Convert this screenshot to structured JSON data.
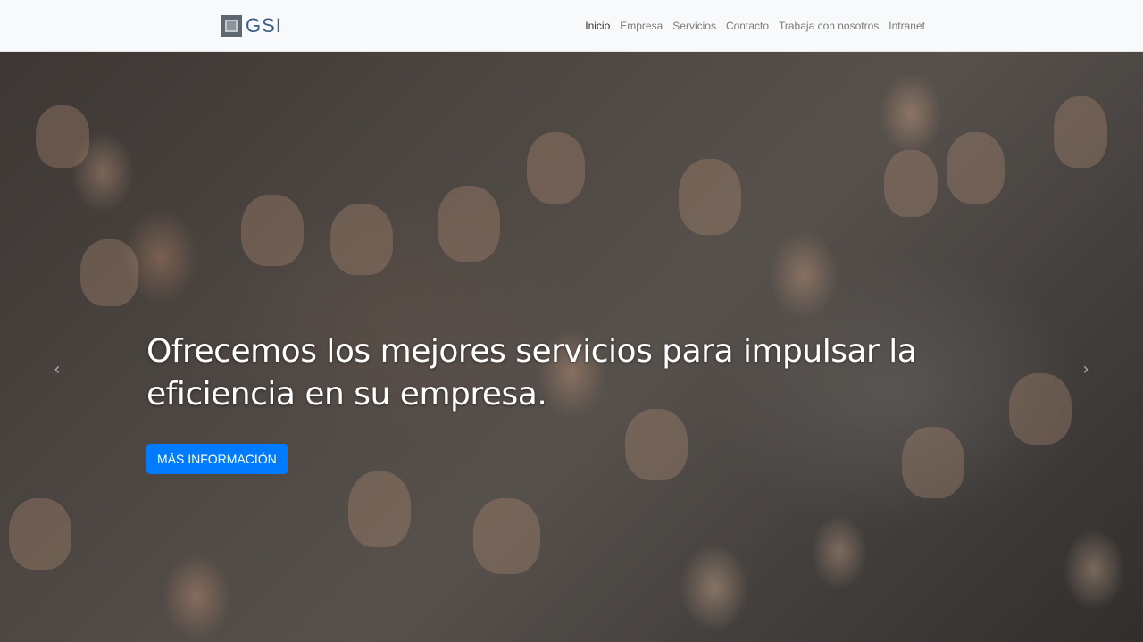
{
  "nav": {
    "brand": "GSI",
    "links": [
      {
        "label": "Inicio"
      },
      {
        "label": "Empresa"
      },
      {
        "label": "Servicios"
      },
      {
        "label": "Contacto"
      },
      {
        "label": "Trabaja con nosotros"
      },
      {
        "label": "Intranet"
      }
    ],
    "active_index": 0
  },
  "hero": {
    "background_image": "crowd-of-people-waving-photo",
    "title": "Ofrecemos los mejores servicios para impulsar la eficiencia en su empresa.",
    "cta_label": "MÁS INFORMACIÓN",
    "prev_icon": "chevron-left-icon",
    "next_icon": "chevron-right-icon"
  },
  "colors": {
    "accent": "#007bff",
    "navbar_bg": "#f8f9fa",
    "brand_text": "#3b5e84"
  }
}
